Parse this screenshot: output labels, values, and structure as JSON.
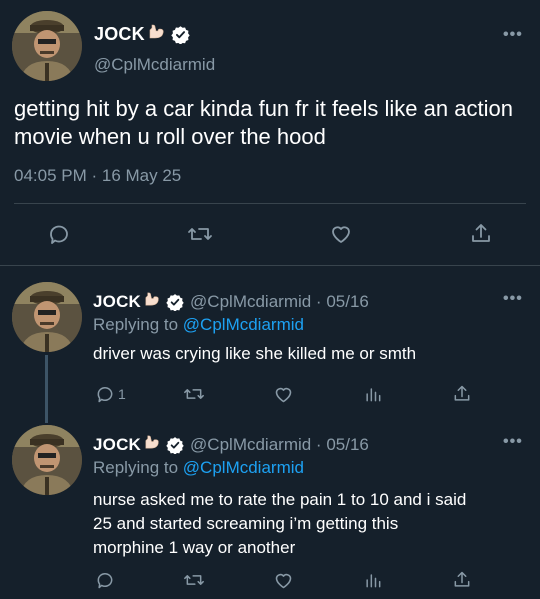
{
  "main_tweet": {
    "author_name": "JOCK",
    "author_handle": "@CplMcdiarmid",
    "text": "getting hit by a car kinda fun fr it feels like an action movie when u roll over the hood",
    "timestamp": "04:05 PM · 16 May 25",
    "actions": [
      "reply-icon",
      "retweet-icon",
      "like-icon",
      "share-icon"
    ]
  },
  "replies": [
    {
      "author_name": "JOCK",
      "author_handle": "@CplMcdiarmid",
      "date": "05/16",
      "handle_date": "@CplMcdiarmid · 05/16",
      "replying_prefix": "Replying to",
      "replying_to": "@CplMcdiarmid",
      "text": "driver was crying like she killed me or smth",
      "reply_count": "1"
    },
    {
      "author_name": "JOCK",
      "author_handle": "@CplMcdiarmid",
      "date": "05/16",
      "handle_date": "@CplMcdiarmid · 05/16",
      "replying_prefix": "Replying to",
      "replying_to": "@CplMcdiarmid",
      "text_lines": [
        "nurse asked me to rate the pain 1 to 10 and i said",
        "25 and started screaming i’m getting this",
        "morphine 1 way or another"
      ],
      "reply_count": ""
    }
  ],
  "colors": {
    "background": "#15202b",
    "text": "#ffffff",
    "muted": "#8899a6",
    "link": "#1da1f2",
    "divider": "#38444d"
  }
}
